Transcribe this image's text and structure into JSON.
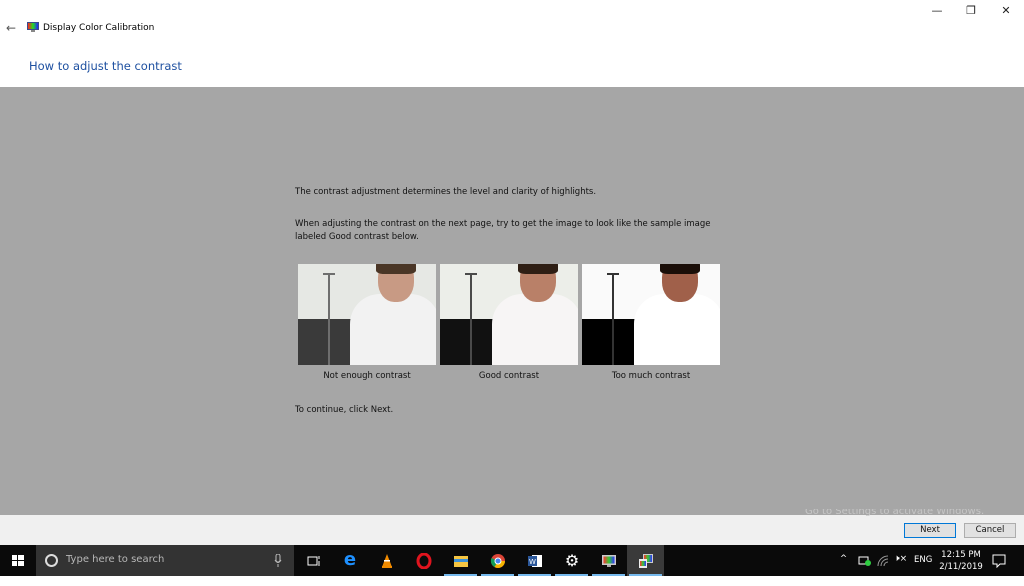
{
  "window": {
    "title": "Display Color Calibration",
    "controls": {
      "minimize": "—",
      "restore": "❐",
      "close": "✕"
    },
    "back_icon": "←"
  },
  "page": {
    "heading": "How to adjust the contrast",
    "intro": "The contrast adjustment determines the level and clarity of highlights.",
    "instruction": "When adjusting the contrast on the next page, try to get the image to look like the sample image labeled Good contrast below.",
    "continue_text": "To continue, click Next.",
    "samples": [
      {
        "label": "Not enough contrast",
        "top_color": "#e6e8e4",
        "bottom_color": "#3a3a3a",
        "pole_color": "#6e6e6e",
        "shirt_color": "#f2f2f2",
        "skin_color": "#c89a84",
        "hair_color": "#4a3626"
      },
      {
        "label": "Good contrast",
        "top_color": "#eceee9",
        "bottom_color": "#111111",
        "pole_color": "#4a4a4a",
        "shirt_color": "#f7f5f5",
        "skin_color": "#b98068",
        "hair_color": "#2e1e14"
      },
      {
        "label": "Too much contrast",
        "top_color": "#fafafa",
        "bottom_color": "#000000",
        "pole_color": "#333333",
        "shirt_color": "#ffffff",
        "skin_color": "#a0604a",
        "hair_color": "#1a0e08"
      }
    ]
  },
  "footer": {
    "watermark": "Go to Settings to activate Windows.",
    "next_label": "Next",
    "cancel_label": "Cancel"
  },
  "taskbar": {
    "search_placeholder": "Type here to search",
    "apps": [
      {
        "name": "task-view",
        "glyph": "⧉",
        "color": "#ffffff"
      },
      {
        "name": "edge",
        "glyph": "e",
        "color": "#1e90ff"
      },
      {
        "name": "vlc",
        "glyph": "▲",
        "color": "#f08a00"
      },
      {
        "name": "opera",
        "glyph": "O",
        "color": "#e0141e"
      },
      {
        "name": "file-explorer",
        "glyph": "▬",
        "color": "#f5c542"
      },
      {
        "name": "chrome",
        "glyph": "●",
        "color": "#4caf50"
      },
      {
        "name": "word",
        "glyph": "W",
        "color": "#2b579a"
      },
      {
        "name": "settings",
        "glyph": "⚙",
        "color": "#ffffff"
      },
      {
        "name": "display-calibration",
        "glyph": "▣",
        "color": "#9ad"
      },
      {
        "name": "display-color-calibration-active",
        "glyph": "▣",
        "color": "#9ad"
      }
    ],
    "tray": {
      "chevron": "^",
      "language": "ENG",
      "time": "12:15 PM",
      "date": "2/11/2019"
    }
  }
}
